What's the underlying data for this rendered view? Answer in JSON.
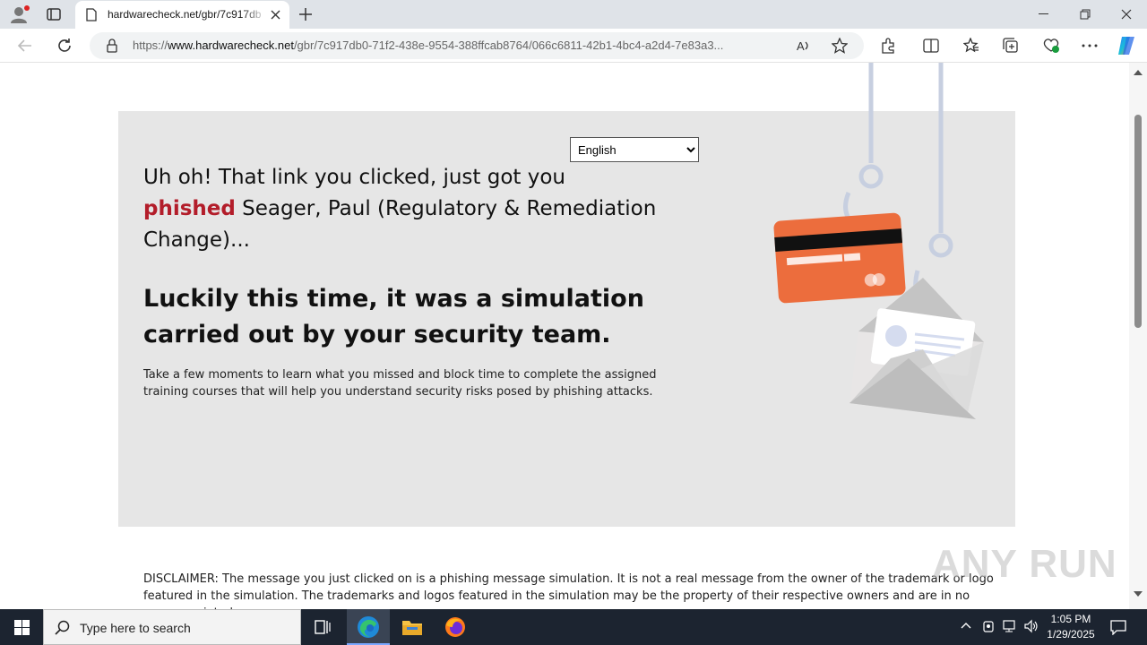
{
  "browser": {
    "tab_title": "hardwarecheck.net/gbr/7c917db",
    "url_prefix": "https://",
    "url_domain": "www.hardwarecheck.net",
    "url_path": "/gbr/7c917db0-71f2-438e-9554-388ffcab8764/066c6811-42b1-4bc4-a2d4-7e83a3...",
    "icons": [
      "profile-icon",
      "tab-actions-icon",
      "page-icon",
      "close-tab-icon",
      "new-tab-icon",
      "minimize-icon",
      "restore-icon",
      "close-window-icon",
      "back-icon",
      "refresh-icon",
      "lock-icon",
      "read-aloud-icon",
      "favorite-icon",
      "extensions-icon",
      "split-screen-icon",
      "favorites-icon",
      "collections-icon",
      "browser-essentials-icon",
      "more-icon",
      "copilot-icon"
    ]
  },
  "page": {
    "language_selected": "English",
    "headline_part1": "Uh oh! That link you clicked, just got you",
    "headline_red": "phished",
    "headline_part2": " Seager, Paul (Regulatory & Remediation Change)...",
    "subhead": "Luckily this time, it was a simulation carried out by your security team.",
    "body": "Take a few moments to learn what you missed and block time to complete the assigned training courses that will help you understand security risks posed by phishing attacks.",
    "disclaimer": "DISCLAIMER: The message you just clicked on is a phishing message simulation. It is not a real message from the owner of the trademark or logo featured in the simulation. The trademarks and logos featured in the simulation may be the property of their respective owners and are in no way associated or"
  },
  "taskbar": {
    "search_placeholder": "Type here to search",
    "time": "1:05 PM",
    "date": "1/29/2025"
  },
  "watermark": "ANY RUN",
  "colors": {
    "phished_red": "#b31d2a",
    "card_orange": "#ec6d3d",
    "panel_gray": "#e6e6e6",
    "taskbar": "#1c2430"
  }
}
